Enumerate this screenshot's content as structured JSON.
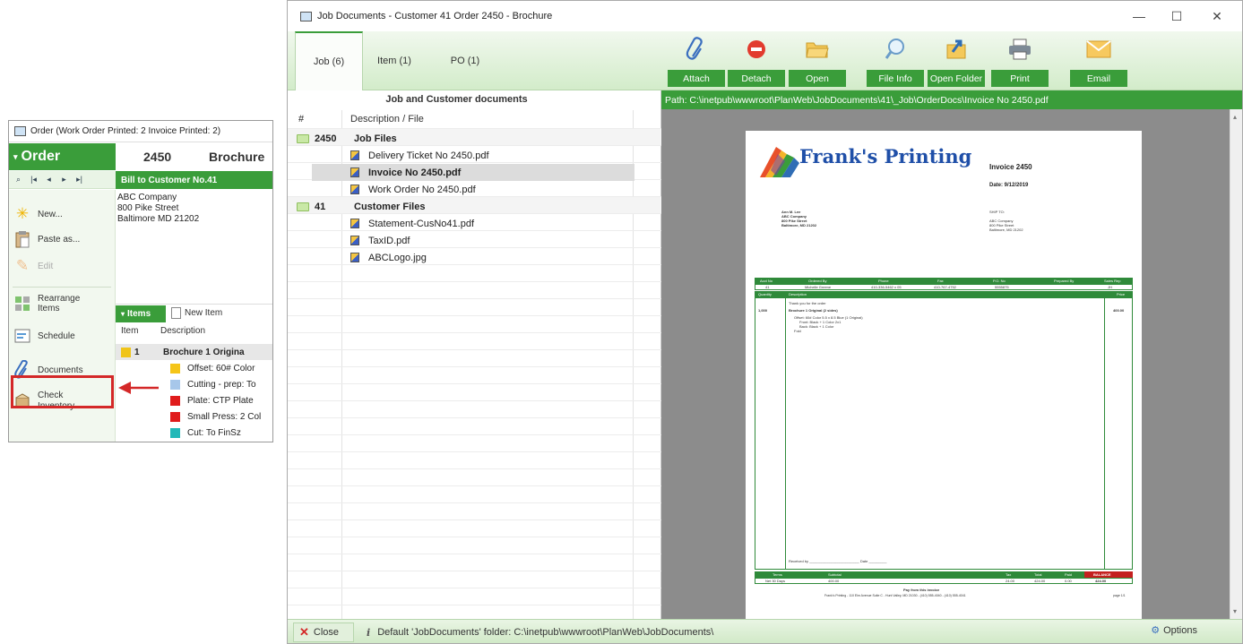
{
  "order_window": {
    "title": "Order (Work Order Printed: 2  Invoice Printed: 2)",
    "tab_label": "Order",
    "order_number": "2450",
    "order_name": "Brochure",
    "nav_buttons": [
      "⌕",
      "|◂",
      "◂",
      "▸",
      "▸|"
    ],
    "bill_to": "Bill to Customer No.41",
    "address": [
      "ABC Company",
      "800 Pike Street",
      "Baltimore MD 21202"
    ],
    "side_buttons": [
      "New...",
      "Paste as...",
      "Edit",
      "Rearrange Items",
      "Schedule",
      "Documents",
      "Check Inventory"
    ],
    "items_tab": "Items",
    "new_item": "New Item",
    "items_headers": [
      "Item",
      "Description"
    ],
    "items": [
      {
        "num": "1",
        "desc": "Brochure  1 Origina",
        "color": "#f0c419",
        "bold": true
      },
      {
        "num": "",
        "desc": "Offset: 60# Color",
        "color": "#f5c518",
        "bold": false
      },
      {
        "num": "",
        "desc": "Cutting - prep: To",
        "color": "#a7c7ea",
        "bold": false
      },
      {
        "num": "",
        "desc": "Plate: CTP Plate",
        "color": "#e01b1b",
        "bold": false
      },
      {
        "num": "",
        "desc": "Small Press: 2 Col",
        "color": "#e01b1b",
        "bold": false
      },
      {
        "num": "",
        "desc": "Cut: To FinSz",
        "color": "#22b8b8",
        "bold": false
      }
    ]
  },
  "main_window": {
    "title": "Job Documents - Customer 41 Order 2450 - Brochure",
    "controls": [
      "—",
      "☐",
      "✕"
    ],
    "tabs": [
      "Job (6)",
      "Item (1)",
      "PO (1)"
    ],
    "ribbon_buttons": [
      "Attach",
      "Detach",
      "Open",
      "File Info",
      "Open Folder",
      "Print",
      "Email"
    ],
    "tree": {
      "title": "Job and Customer documents",
      "col_hash": "#",
      "col_desc": "Description / File",
      "groups": [
        {
          "id": "2450",
          "label": "Job Files",
          "files": [
            "Delivery Ticket No 2450.pdf",
            "Invoice No 2450.pdf",
            "Work Order No 2450.pdf"
          ]
        },
        {
          "id": "41",
          "label": "Customer Files",
          "files": [
            "Statement-CusNo41.pdf",
            "TaxID.pdf",
            "ABCLogo.jpg"
          ]
        }
      ],
      "selected_file": "Invoice No 2450.pdf"
    },
    "preview": {
      "path": "Path: C:\\inetpub\\wwwroot\\PlanWeb\\JobDocuments\\41\\_Job\\OrderDocs\\Invoice No 2450.pdf",
      "company": "Frank's Printing",
      "invoice_title": "Invoice 2450",
      "invoice_date": "Date: 9/12/2019",
      "bill_block": [
        "Ann M. Lee",
        "ABC Company",
        "800 Pike Street",
        "Baltimore, MD 21202"
      ],
      "ship_block": [
        "SHIP TO:",
        "ABC Company",
        "800 Pike Street",
        "Baltimore, MD 21202"
      ],
      "table_headers": [
        "Acct No",
        "Ordered By",
        "Phone",
        "Fax",
        "P.O. No",
        "Prepared By",
        "Sales Rep"
      ],
      "table_row": [
        "41",
        "Michelle Greene",
        "410-336-5462 x 05",
        "410-767-4752",
        "5555875",
        "",
        "JH"
      ],
      "qty_head": "Quantity",
      "desc_head": "Description",
      "price_head": "Price",
      "line_qty": "1,000",
      "line_desc": "Brochure  1 Original (2 sides)",
      "line_price": "400.00",
      "line_detail": [
        "Offset: 60# Color 5.5 x 8.5 Blue  (1 Original)",
        "Front: Black + 1 Color  2x1",
        "Back: Black + 1 Color",
        "Fold"
      ],
      "thanks": "Thank you for the order",
      "received_by": "Received by _________________________  Date _________",
      "totals_headers": [
        "Terms",
        "Subtotal",
        "",
        "",
        "",
        "Tax",
        "Total",
        "Paid",
        "BALANCE"
      ],
      "totals_values": [
        "Net 30 Days",
        "400.00",
        "",
        "",
        "",
        "24.00",
        "424.00",
        "0.00",
        "424.00"
      ],
      "pay_text": "Pay from this invoice",
      "footer_text": "Frank's Printing - 110 Elm Avenue Suite C - Hunt Valley, MD 21030 - (410) 555-4040 - (410) 555-4041",
      "page_label": "page 1/1"
    },
    "status": {
      "close_label": "Close",
      "info_text": "Default 'JobDocuments' folder: C:\\inetpub\\wwwroot\\PlanWeb\\JobDocuments\\",
      "options_label": "Options"
    }
  },
  "colors": {
    "accent_green": "#3a9d3a",
    "highlight_red": "#d42828"
  }
}
